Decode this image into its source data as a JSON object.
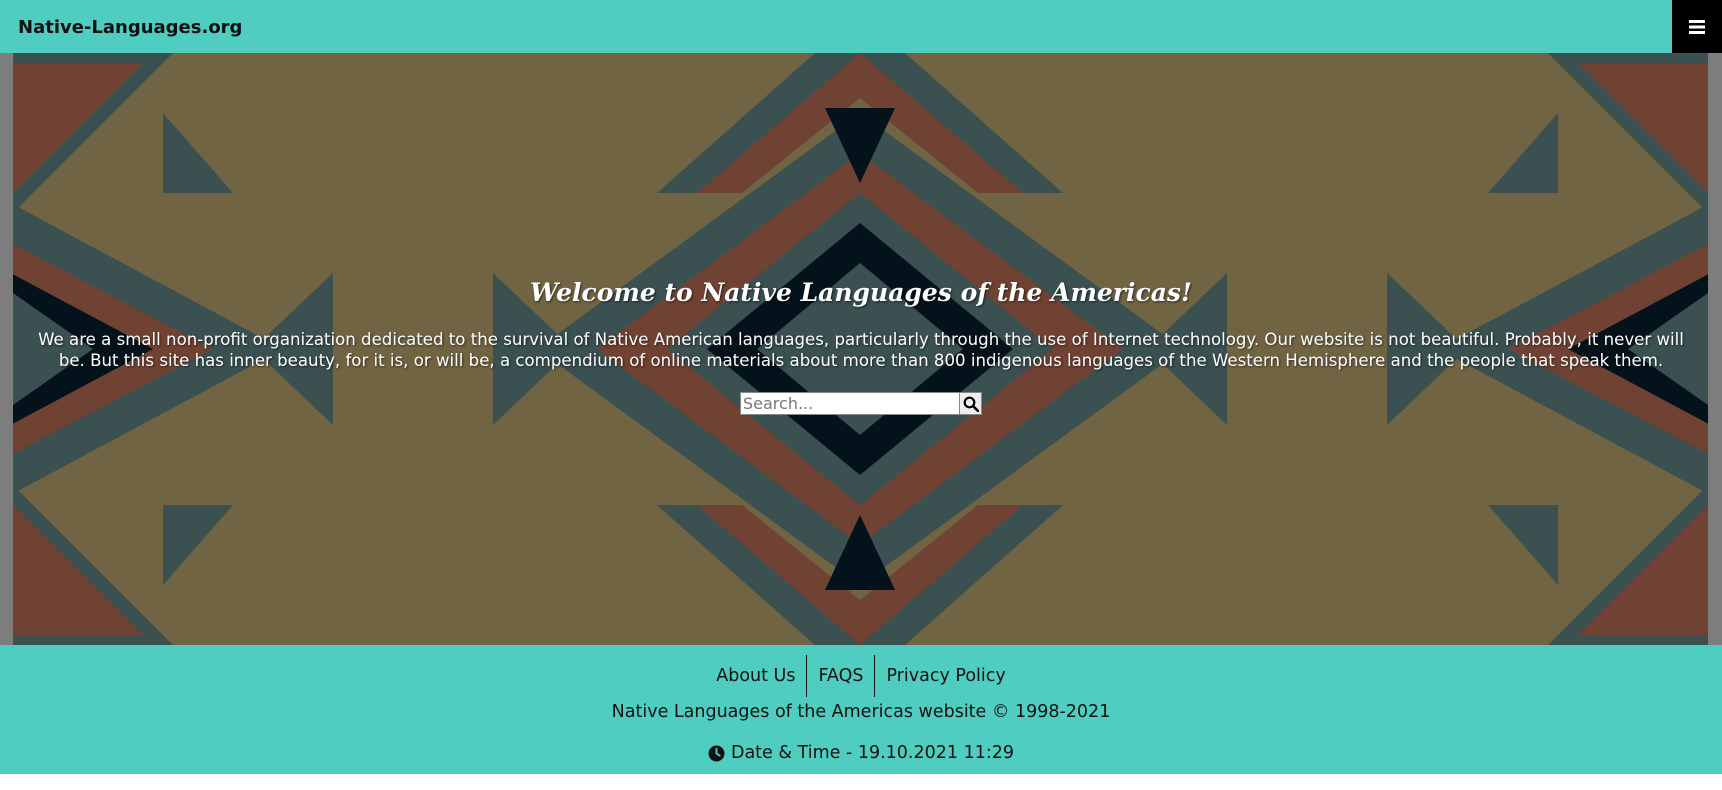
{
  "navbar": {
    "brand": "Native-Languages.org",
    "menu_icon": "hamburger-menu-icon",
    "background": "#4ecdc0"
  },
  "hero": {
    "title": "Welcome to Native Languages of the Americas!",
    "intro_line1": "We are a small non-profit organization dedicated to the survival of Native American languages, particularly through the use of Internet technology. Our website is not beautiful. Probably, it never will",
    "intro_line2": "be. But this site has inner beauty, for it is, or will be, a compendium of online materials about more than 800 indigenous languages of the Western Hemisphere and the people that speak them.",
    "pattern_colors": {
      "tan": "#776b48",
      "rust": "#774737",
      "slate": "#3e5557",
      "dark": "#05141d",
      "frame": "#7d7d7d"
    }
  },
  "search": {
    "placeholder": "Search...",
    "button_icon": "search-icon"
  },
  "footer": {
    "links": [
      "About Us",
      "FAQS",
      "Privacy Policy"
    ],
    "copyright": "Native Languages of the Americas website © 1998-2021",
    "datetime_label": "Date & Time - 19.10.2021 11:29",
    "clock_icon": "clock-icon",
    "background": "#4ecdc0"
  }
}
